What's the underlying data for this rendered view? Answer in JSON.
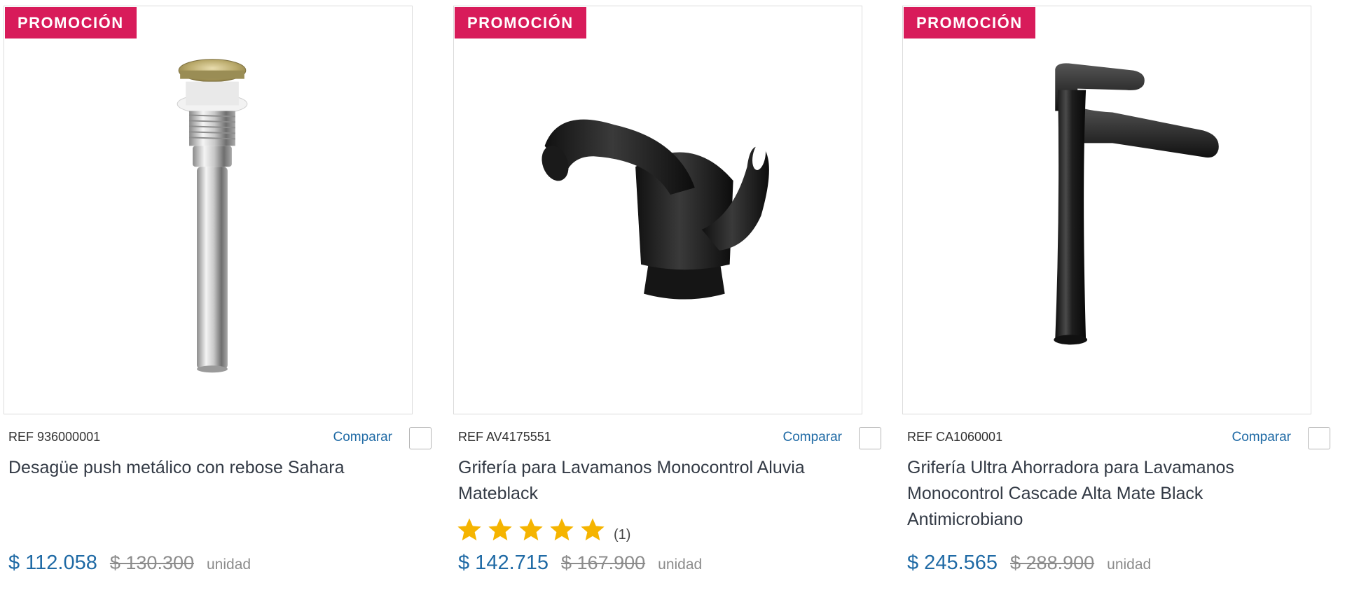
{
  "products": [
    {
      "badge": "PROMOCIÓN",
      "ref": "REF 936000001",
      "compare_label": "Comparar",
      "title": "Desagüe push metálico con rebose Sahara",
      "price": "$ 112.058",
      "old_price": "$ 130.300",
      "unit": "unidad",
      "image_icon": "chrome-drain-image"
    },
    {
      "badge": "PROMOCIÓN",
      "ref": "REF AV4175551",
      "compare_label": "Comparar",
      "title": "Grifería para Lavamanos Monocontrol Aluvia Mateblack",
      "rating": {
        "stars": 5,
        "max": 5,
        "count_label": "(1)"
      },
      "price": "$ 142.715",
      "old_price": "$ 167.900",
      "unit": "unidad",
      "image_icon": "black-faucet-image"
    },
    {
      "badge": "PROMOCIÓN",
      "ref": "REF CA1060001",
      "compare_label": "Comparar",
      "title": "Grifería Ultra Ahorradora para Lavamanos Monocontrol Cascade Alta Mate Black Antimicrobiano",
      "price": "$ 245.565",
      "old_price": "$ 288.900",
      "unit": "unidad",
      "image_icon": "tall-black-faucet-image"
    }
  ],
  "colors": {
    "badge": "#d81b5a",
    "price": "#1f6aa5",
    "link": "#1f6aa5",
    "star": "#f5b400"
  }
}
